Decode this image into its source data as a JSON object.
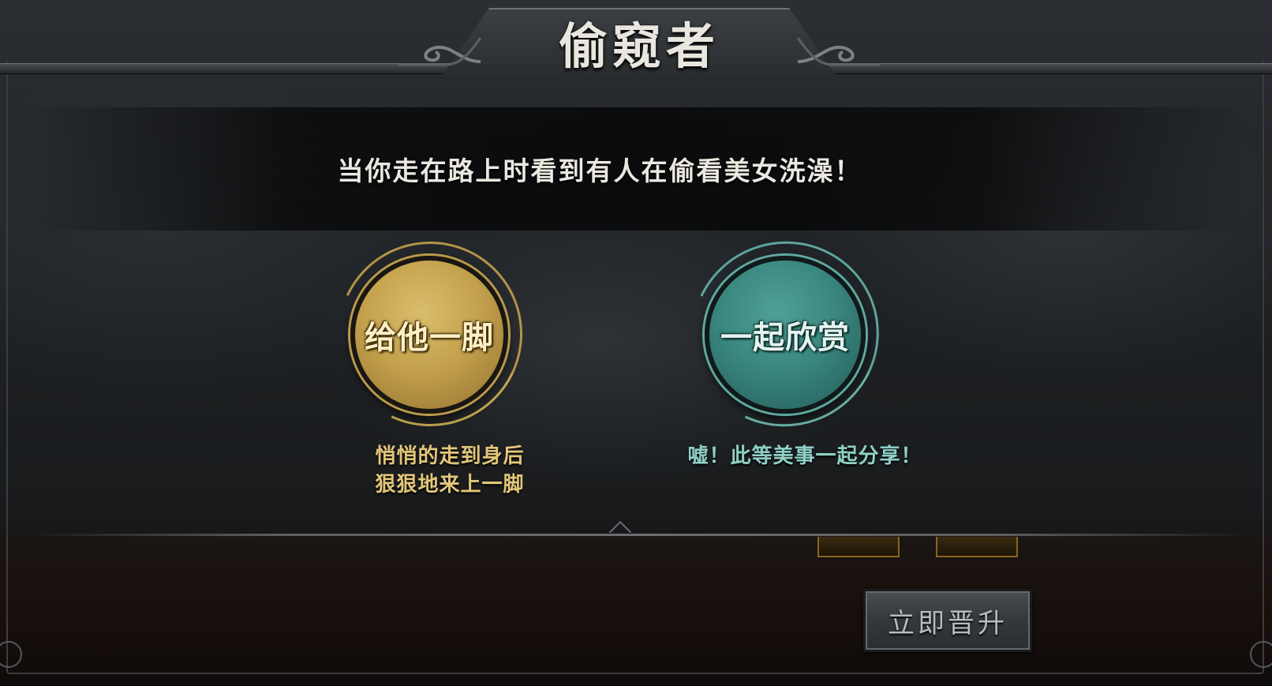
{
  "dialog": {
    "title": "偷窥者",
    "prompt": "当你走在路上时看到有人在偷看美女洗澡！"
  },
  "choices": [
    {
      "label": "给他一脚",
      "description_line1": "悄悄的走到身后",
      "description_line2": "狠狠地来上一脚",
      "color": "#c4a24d"
    },
    {
      "label": "一起欣赏",
      "description_line1": "嘘！此等美事一起分享！",
      "color": "#3a877f"
    }
  ],
  "footer": {
    "promote_button_label": "立即晋升"
  }
}
